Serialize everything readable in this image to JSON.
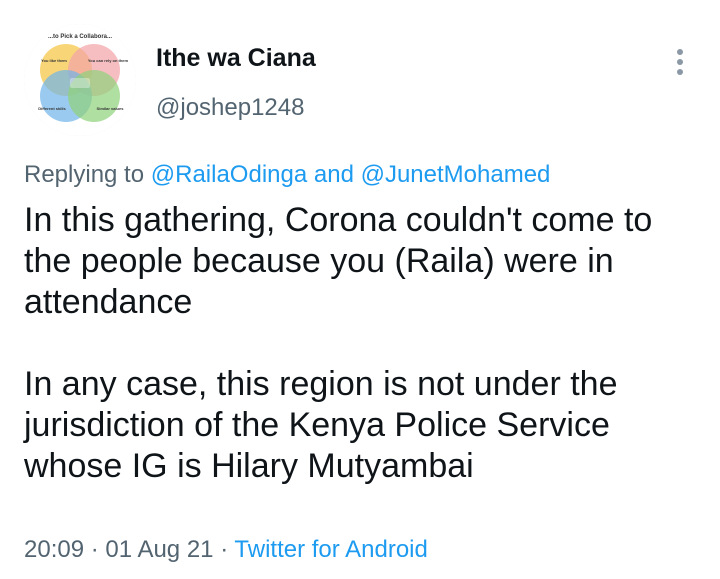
{
  "tweet": {
    "author": {
      "display_name": "Ithe wa Ciana",
      "handle": "@joshep1248",
      "avatar": {
        "title": "...to Pick a Collabora...",
        "labels": {
          "top_left": "You like them",
          "top_right": "You can rely on them",
          "bottom_left": "Different skills",
          "bottom_right": "Similar values"
        }
      }
    },
    "replying": {
      "prefix": "Replying to",
      "mention_1": "@RailaOdinga",
      "conjunction": "and",
      "mention_2": "@JunetMohamed"
    },
    "text": "In this gathering, Corona couldn't come to the people because you (Raila) were in attendance\n\nIn any case, this region is not under the jurisdiction of the Kenya Police Service whose IG is Hilary Mutyambai",
    "meta": {
      "time": "20:09",
      "separator_1": "·",
      "date": "01 Aug 21",
      "separator_2": "·",
      "source": "Twitter for Android"
    }
  },
  "icons": {
    "more": "more-vertical-icon"
  },
  "colors": {
    "text": "#0f1419",
    "secondary": "#536471",
    "link": "#1d9bf0"
  }
}
